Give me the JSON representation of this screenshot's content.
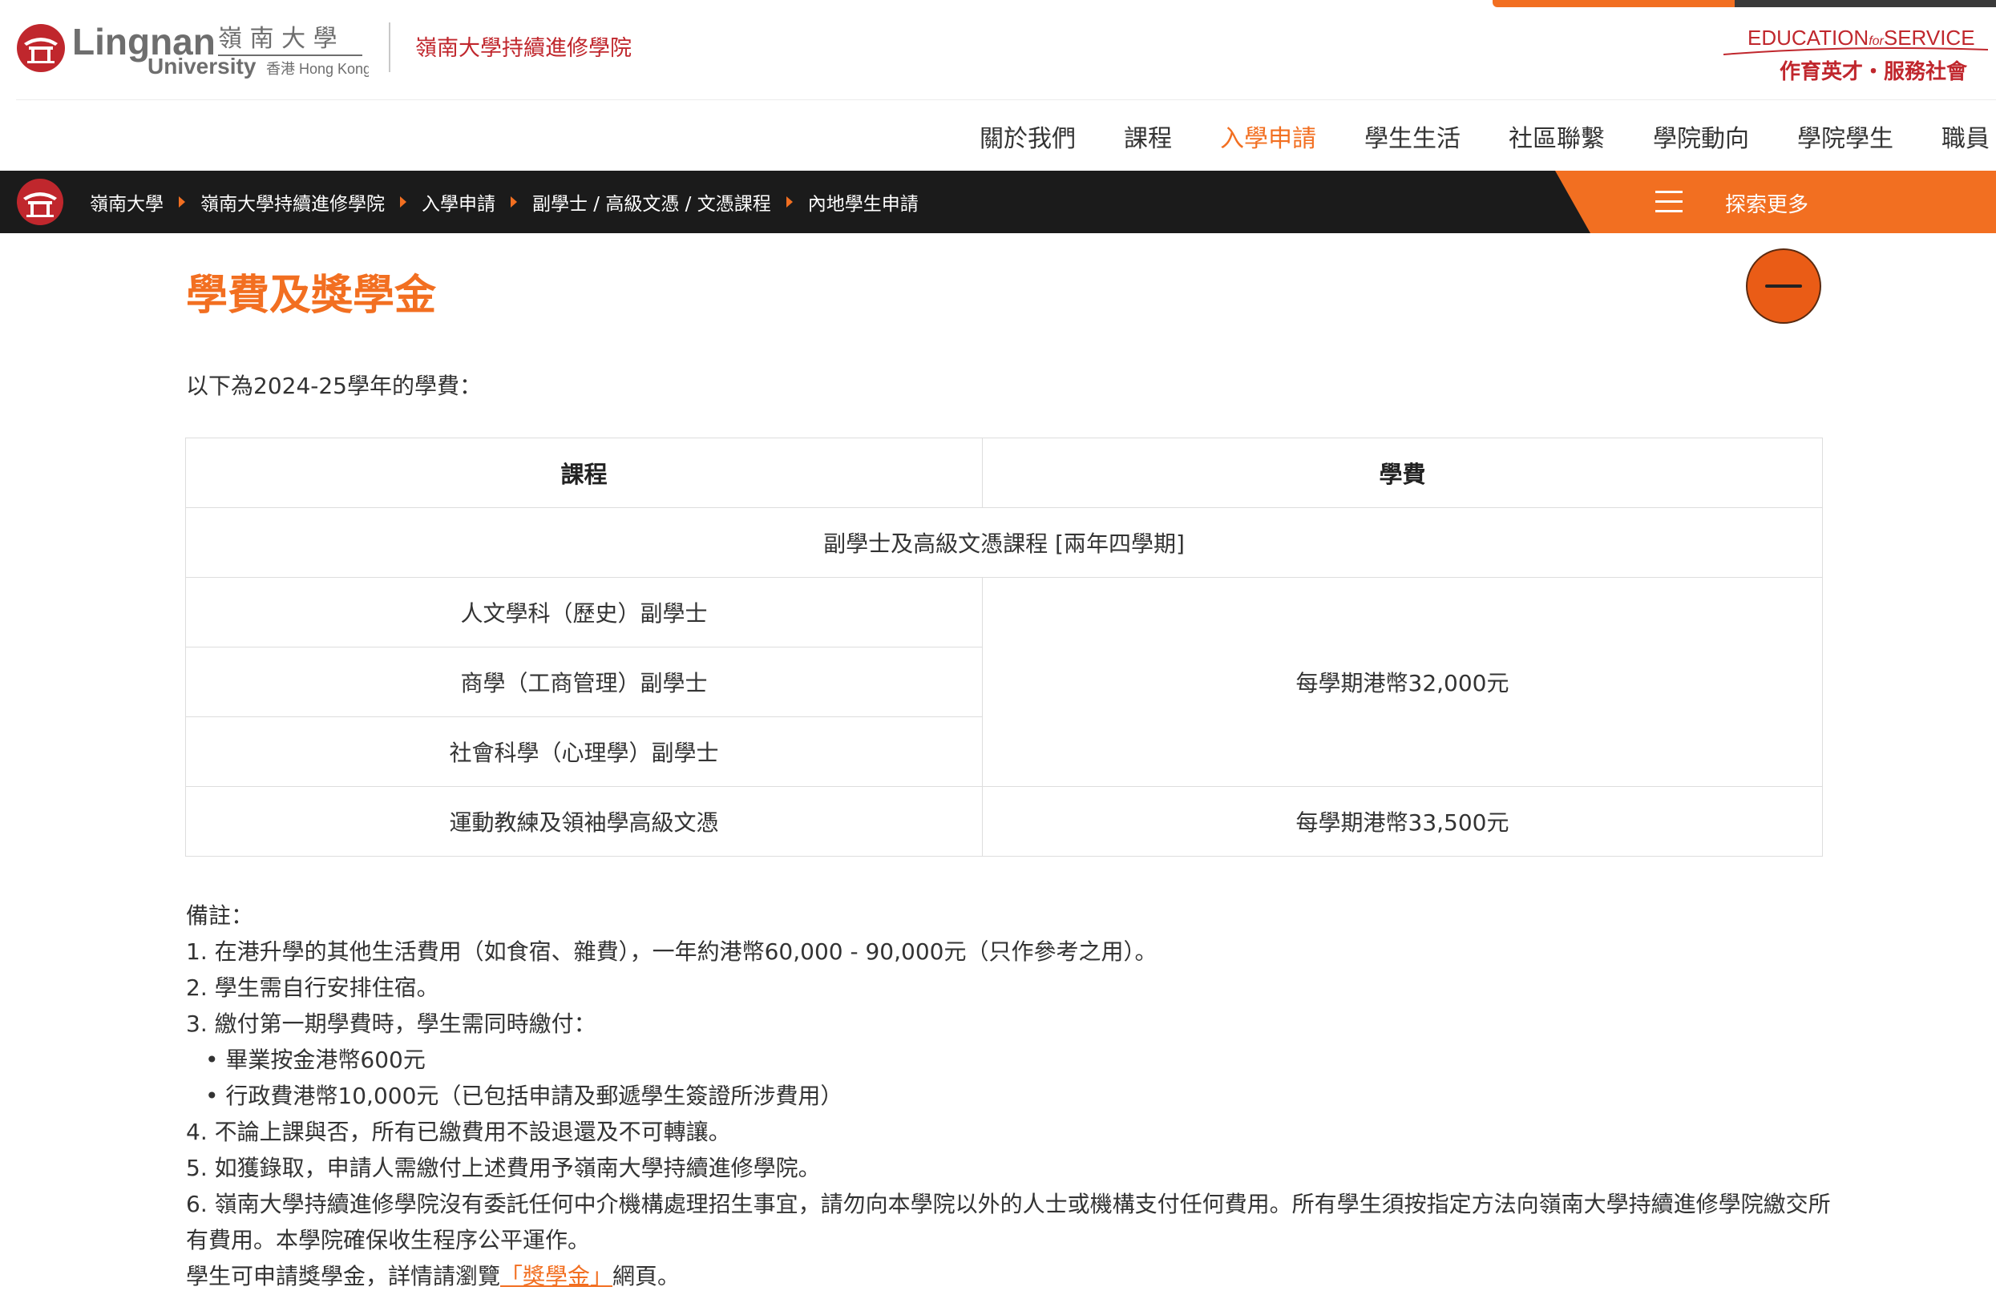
{
  "header": {
    "logo": {
      "wordmark": "Lingnan",
      "chinese": "嶺 南 大 學",
      "sub": "University",
      "location": "香港 Hong Kong"
    },
    "school_name": "嶺南大學持續進修學院",
    "slogan": {
      "en_main": "EDUCATION",
      "en_for": "for",
      "en_service": "SERVICE",
      "zh": "作育英才・服務社會"
    }
  },
  "nav": {
    "items": [
      {
        "label": "關於我們",
        "active": false
      },
      {
        "label": "課程",
        "active": false
      },
      {
        "label": "入學申請",
        "active": true
      },
      {
        "label": "學生生活",
        "active": false
      },
      {
        "label": "社區聯繫",
        "active": false
      },
      {
        "label": "學院動向",
        "active": false
      },
      {
        "label": "學院學生",
        "active": false
      },
      {
        "label": "職員",
        "active": false
      }
    ]
  },
  "breadcrumb": {
    "items": [
      "嶺南大學",
      "嶺南大學持續進修學院",
      "入學申請",
      "副學士 / 高級文憑 / 文憑課程",
      "內地學生申請"
    ],
    "explore_label": "探索更多"
  },
  "section": {
    "title": "學費及獎學金",
    "intro": "以下為2024-25學年的學費："
  },
  "table": {
    "headers": [
      "課程",
      "學費"
    ],
    "group_label": "副學士及高級文憑課程 [兩年四學期]",
    "rows": [
      "人文學科（歷史）副學士",
      "商學（工商管理）副學士",
      "社會科學（心理學）副學士",
      "運動教練及領袖學高級文憑"
    ],
    "fees": [
      "每學期港幣32,000元",
      "每學期港幣33,500元"
    ]
  },
  "notes": {
    "heading": "備註：",
    "n1": "1. 在港升學的其他生活費用（如食宿、雜費），一年約港幣60,000 - 90,000元（只作參考之用）。",
    "n2": "2. 學生需自行安排住宿。",
    "n3": "3. 繳付第一期學費時，學生需同時繳付：",
    "b1": "• 畢業按金港幣600元",
    "b2": "• 行政費港幣10,000元（已包括申請及郵遞學生簽證所涉費用）",
    "n4": "4. 不論上課與否，所有已繳費用不設退還及不可轉讓。",
    "n5": "5. 如獲錄取，申請人需繳付上述費用予嶺南大學持續進修學院。",
    "n6": "6. 嶺南大學持續進修學院沒有委託任何中介機構處理招生事宜，請勿向本學院以外的人士或機構支付任何費用。所有學生須按指定方法向嶺南大學持續進修學院繳交所有費用。本學院確保收生程序公平運作。",
    "scholarship_prefix": "學生可申請獎學金，詳情請瀏覽",
    "scholarship_link": "「獎學金」",
    "scholarship_suffix": "網頁。"
  },
  "colors": {
    "accent": "#f26f21",
    "brand_red": "#c0272d",
    "dark_bar": "#1b1b1b"
  }
}
